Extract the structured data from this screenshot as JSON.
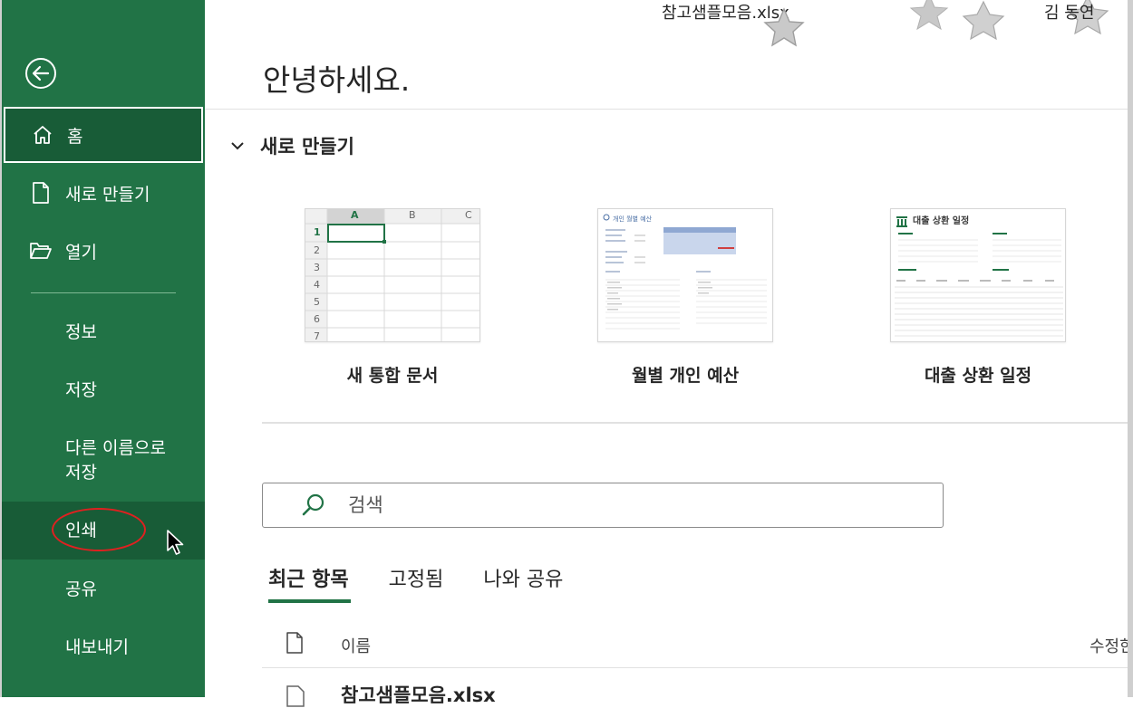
{
  "window": {
    "file_title": "참고샘플모음.xlsx",
    "user_name": "김 동연"
  },
  "sidebar": {
    "back_icon": "back-arrow-icon",
    "items": [
      {
        "label": "홈",
        "icon": "home-icon",
        "active": true
      },
      {
        "label": "새로 만들기",
        "icon": "new-document-icon"
      },
      {
        "label": "열기",
        "icon": "open-folder-icon"
      },
      {
        "label": "정보"
      },
      {
        "label": "저장"
      },
      {
        "label": "다른 이름으로 저장"
      },
      {
        "label": "인쇄",
        "hovered": true
      },
      {
        "label": "공유"
      },
      {
        "label": "내보내기"
      }
    ],
    "save_as_line1": "다른 이름으로",
    "save_as_line2": "저장"
  },
  "main": {
    "greeting": "안녕하세요.",
    "new_section": {
      "title": "새로 만들기",
      "templates": [
        {
          "label": "새 통합 문서"
        },
        {
          "label": "월별 개인 예산",
          "thumb_title": "개인 월별 예산"
        },
        {
          "label": "대출 상환 일정",
          "thumb_title": "대출 상환 일정"
        }
      ],
      "grid_cols": [
        "A",
        "B",
        "C"
      ],
      "grid_rows": [
        "1",
        "2",
        "3",
        "4",
        "5",
        "6",
        "7"
      ]
    },
    "search": {
      "placeholder": "검색"
    },
    "tabs": [
      {
        "label": "최근 항목",
        "active": true
      },
      {
        "label": "고정됨"
      },
      {
        "label": "나와 공유"
      }
    ],
    "list": {
      "col_name": "이름",
      "col_modified": "수정한",
      "rows": [
        {
          "name": "참고샘플모음.xlsx"
        }
      ]
    }
  },
  "colors": {
    "sidebar_bg": "#217346",
    "sidebar_active": "#185c37",
    "accent": "#217346",
    "annotation_red": "#e02020"
  }
}
